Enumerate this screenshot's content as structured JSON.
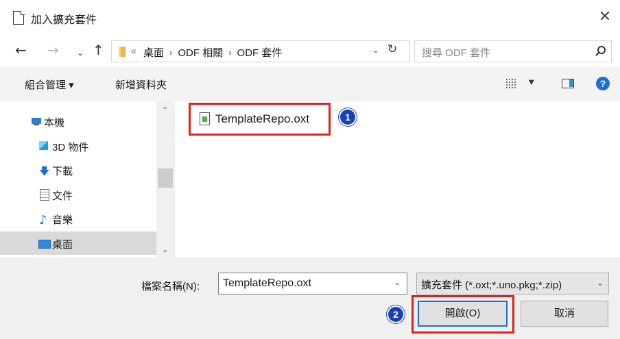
{
  "window": {
    "title": "加入擴充套件",
    "close_label": "✕"
  },
  "address": {
    "overflow": "«",
    "breadcrumbs": [
      "桌面",
      "ODF 相關",
      "ODF 套件"
    ],
    "search_placeholder": "搜尋 ODF 套件"
  },
  "toolbar": {
    "organize_label": "組合管理 ▾",
    "new_folder_label": "新增資料夾",
    "help_label": "?"
  },
  "nav_pane": {
    "items": [
      {
        "label": "本機",
        "icon": "computer-icon"
      },
      {
        "label": "3D 物件",
        "icon": "cube-icon"
      },
      {
        "label": "下載",
        "icon": "download-icon"
      },
      {
        "label": "文件",
        "icon": "document-icon"
      },
      {
        "label": "音樂",
        "icon": "music-icon"
      },
      {
        "label": "桌面",
        "icon": "desktop-icon",
        "selected": true
      }
    ]
  },
  "files": [
    {
      "name": "TemplateRepo.oxt",
      "icon": "extension-file-icon"
    }
  ],
  "bottom": {
    "filename_label": "檔案名稱(N):",
    "filename_value": "TemplateRepo.oxt",
    "filter_value": "擴充套件 (*.oxt;*.uno.pkg;*.zip)",
    "open_label": "開啟(O)",
    "cancel_label": "取消"
  },
  "annotations": {
    "badge_1": "1",
    "badge_2": "2"
  },
  "colors": {
    "highlight_frame": "#e02020",
    "badge": "#1b3fb8",
    "accent": "#1b6fd1"
  }
}
